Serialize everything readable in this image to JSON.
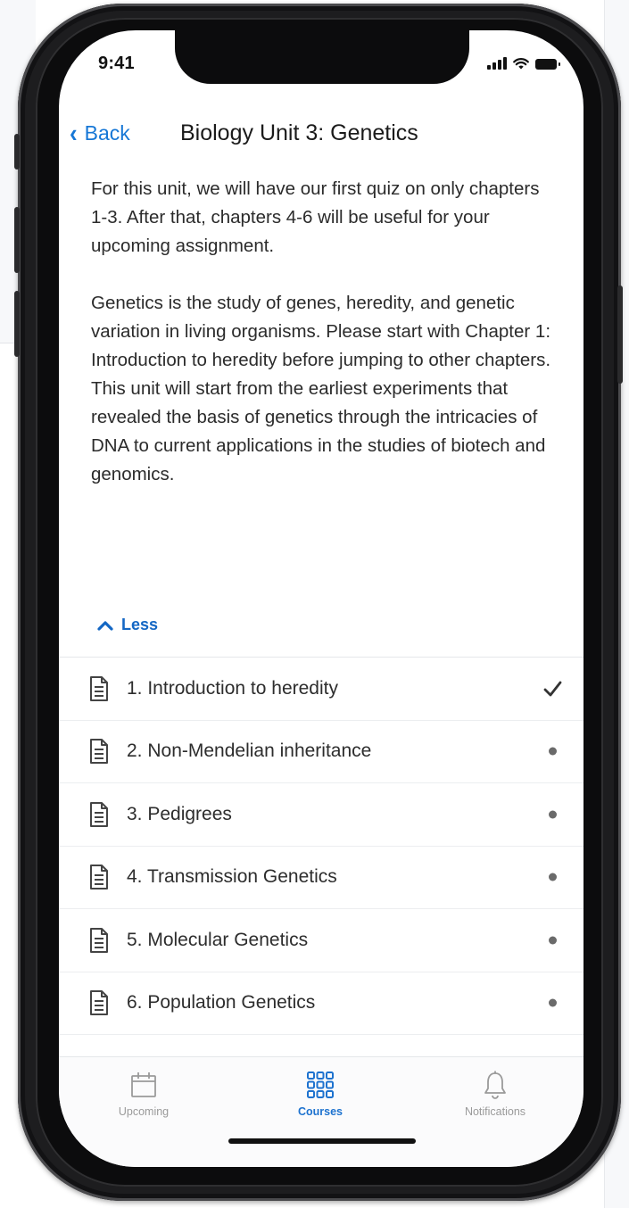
{
  "status_bar": {
    "time": "9:41",
    "icons": [
      "cellular-signal-icon",
      "wifi-icon",
      "battery-icon"
    ]
  },
  "nav": {
    "back_label": "Back",
    "title": "Biology Unit 3: Genetics"
  },
  "description": {
    "paragraphs": [
      "For this unit, we will have our first quiz on only chapters 1-3. After that, chapters 4-6 will be useful for your upcoming assignment.",
      "Genetics is the study of genes, heredity, and genetic variation in living organisms. Please start with Chapter 1: Introduction to heredity before jumping to other chapters. This unit will start from the earliest experiments that revealed the basis of genetics through the intricacies of DNA to current applications in the studies of biotech and genomics."
    ]
  },
  "toggle": {
    "label": "Less",
    "icon": "chevron-up-icon"
  },
  "chapters": [
    {
      "title": "1. Introduction to heredity",
      "status": "completed",
      "icon": "document-icon"
    },
    {
      "title": "2. Non-Mendelian inheritance",
      "status": "pending",
      "icon": "document-icon"
    },
    {
      "title": "3. Pedigrees",
      "status": "pending",
      "icon": "document-icon"
    },
    {
      "title": "4. Transmission Genetics",
      "status": "pending",
      "icon": "document-icon"
    },
    {
      "title": "5. Molecular Genetics",
      "status": "pending",
      "icon": "document-icon"
    },
    {
      "title": "6. Population Genetics",
      "status": "pending",
      "icon": "document-icon"
    }
  ],
  "tabs": [
    {
      "label": "Upcoming",
      "icon": "calendar-icon",
      "active": false
    },
    {
      "label": "Courses",
      "icon": "grid-icon",
      "active": true
    },
    {
      "label": "Notifications",
      "icon": "bell-icon",
      "active": false
    }
  ],
  "colors": {
    "accent": "#1677d6",
    "active_tab": "#1d72cf",
    "inactive_tab": "#9a9a9a",
    "text": "#2b2b2b",
    "status_dot": "#6a6a6a"
  }
}
